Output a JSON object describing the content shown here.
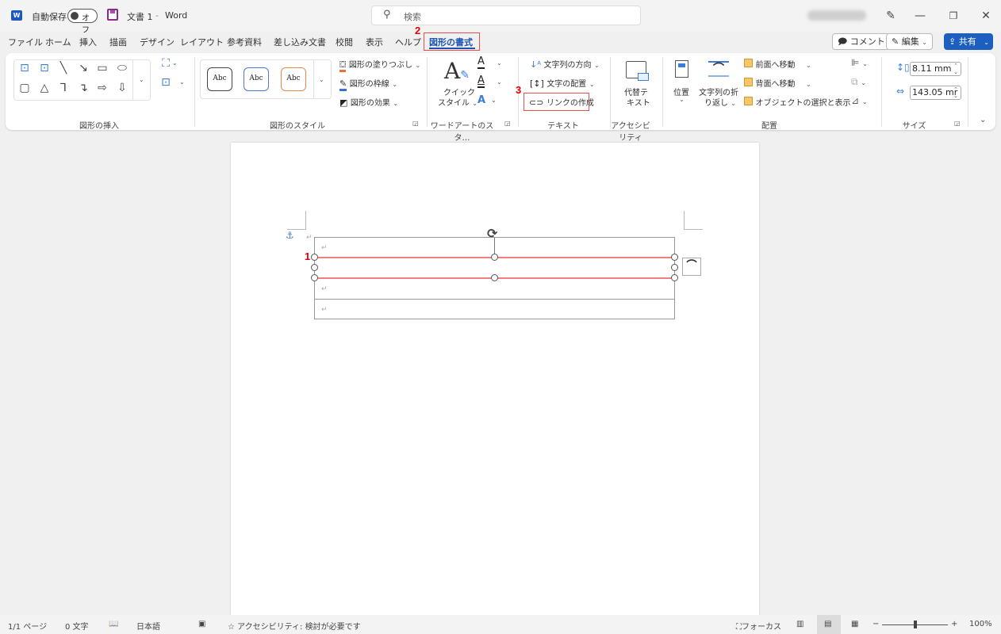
{
  "titlebar": {
    "app_icon": "word-logo-icon",
    "autosave_label": "自動保存",
    "autosave_state": "オフ",
    "document_title": "文書 1",
    "separator": "-",
    "app_name": "Word",
    "search_placeholder": "検索",
    "window_controls": [
      "pen-icon",
      "minimize-icon",
      "restore-icon",
      "close-icon"
    ]
  },
  "menu": {
    "tabs": [
      {
        "label": "ファイル"
      },
      {
        "label": "ホーム"
      },
      {
        "label": "挿入"
      },
      {
        "label": "描画"
      },
      {
        "label": "デザイン"
      },
      {
        "label": "レイアウト"
      },
      {
        "label": "参考資料"
      },
      {
        "label": "差し込み文書"
      },
      {
        "label": "校閲"
      },
      {
        "label": "表示"
      },
      {
        "label": "ヘルプ"
      },
      {
        "label": "図形の書式",
        "active": true
      }
    ],
    "comment_label": "コメント",
    "edit_label": "編集",
    "share_label": "共有"
  },
  "annotations": {
    "one": "1",
    "two": "2",
    "three": "3",
    "color": "#e60000"
  },
  "ribbon": {
    "insert_shapes": {
      "label": "図形の挿入"
    },
    "shape_styles": {
      "label": "図形のスタイル",
      "styles": [
        "Abc",
        "Abc",
        "Abc"
      ],
      "style_colors": [
        "#444444",
        "#4a7bd0",
        "#e8874a"
      ],
      "fill": "図形の塗りつぶし",
      "outline": "図形の枠線",
      "effects": "図形の効果"
    },
    "wordart": {
      "label": "ワードアートのスタ…",
      "quick_style_1": "クイック",
      "quick_style_2": "スタイル"
    },
    "text": {
      "label": "テキスト",
      "direction": "文字列の方向",
      "align": "文字の配置",
      "create_link": "リンクの作成"
    },
    "accessibility": {
      "label": "アクセシビリティ",
      "alt_text_1": "代替テ",
      "alt_text_2": "キスト"
    },
    "arrange": {
      "label": "配置",
      "position": "位置",
      "wrap_1": "文字列の折",
      "wrap_2": "り返し",
      "bring_forward": "前面へ移動",
      "send_backward": "背面へ移動",
      "selection_pane": "オブジェクトの選択と表示"
    },
    "size": {
      "label": "サイズ",
      "height": "8.11 mm",
      "width": "143.05 mr"
    }
  },
  "status": {
    "page": "1/1 ページ",
    "words": "0 文字",
    "language": "日本語",
    "accessibility": "アクセシビリティ: 検討が必要です",
    "focus": "フォーカス",
    "zoom": "100%",
    "zoom_fraction": 0.5
  }
}
